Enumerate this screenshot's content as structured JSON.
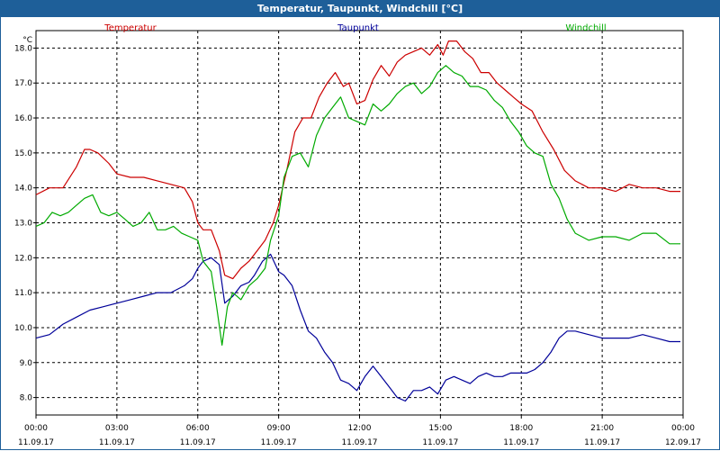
{
  "window": {
    "title": "Temperatur, Taupunkt, Windchill [°C]"
  },
  "chart_data": {
    "type": "line",
    "unit_label": "°C",
    "ylim": [
      7.5,
      18.5
    ],
    "yticks": [
      "8.0",
      "9.0",
      "10.0",
      "11.0",
      "12.0",
      "13.0",
      "14.0",
      "15.0",
      "16.0",
      "17.0",
      "18.0"
    ],
    "xlim": [
      0,
      24
    ],
    "xticks": [
      {
        "time": "00:00",
        "date": "11.09.17"
      },
      {
        "time": "03:00",
        "date": "11.09.17"
      },
      {
        "time": "06:00",
        "date": "11.09.17"
      },
      {
        "time": "09:00",
        "date": "11.09.17"
      },
      {
        "time": "12:00",
        "date": "11.09.17"
      },
      {
        "time": "15:00",
        "date": "11.09.17"
      },
      {
        "time": "18:00",
        "date": "11.09.17"
      },
      {
        "time": "21:00",
        "date": "11.09.17"
      },
      {
        "time": "00:00",
        "date": "12.09.17"
      }
    ],
    "grid": true,
    "legend_position": "top",
    "series": [
      {
        "name": "Temperatur",
        "color": "#cc0000",
        "x": [
          0,
          0.5,
          1,
          1.5,
          1.8,
          2,
          2.3,
          2.7,
          3,
          3.5,
          4,
          4.5,
          5,
          5.5,
          5.8,
          6,
          6.2,
          6.5,
          6.8,
          7,
          7.3,
          7.6,
          7.9,
          8.2,
          8.5,
          8.8,
          9,
          9.3,
          9.6,
          9.9,
          10.2,
          10.5,
          10.8,
          11.1,
          11.4,
          11.6,
          11.9,
          12.2,
          12.5,
          12.8,
          13.1,
          13.4,
          13.7,
          14,
          14.3,
          14.6,
          14.9,
          15.1,
          15.3,
          15.6,
          15.9,
          16.2,
          16.5,
          16.8,
          17.1,
          17.4,
          17.7,
          18,
          18.4,
          18.8,
          19.2,
          19.6,
          20,
          20.5,
          21,
          21.5,
          22,
          22.5,
          23,
          23.5,
          23.9
        ],
        "y": [
          13.8,
          14.0,
          14.0,
          14.6,
          15.1,
          15.1,
          15.0,
          14.7,
          14.4,
          14.3,
          14.3,
          14.2,
          14.1,
          14.0,
          13.6,
          13.0,
          12.8,
          12.8,
          12.2,
          11.5,
          11.4,
          11.7,
          11.9,
          12.2,
          12.5,
          13.0,
          13.5,
          14.5,
          15.6,
          16.0,
          16.0,
          16.6,
          17.0,
          17.3,
          16.9,
          17.0,
          16.4,
          16.5,
          17.1,
          17.5,
          17.2,
          17.6,
          17.8,
          17.9,
          18.0,
          17.8,
          18.1,
          17.8,
          18.2,
          18.2,
          17.9,
          17.7,
          17.3,
          17.3,
          17.0,
          16.8,
          16.6,
          16.4,
          16.2,
          15.6,
          15.1,
          14.5,
          14.2,
          14.0,
          14.0,
          13.9,
          14.1,
          14.0,
          14.0,
          13.9,
          13.9
        ]
      },
      {
        "name": "Taupunkt",
        "color": "#000099",
        "x": [
          0,
          0.5,
          1,
          1.5,
          2,
          2.5,
          3,
          3.5,
          4,
          4.5,
          5,
          5.5,
          5.8,
          6,
          6.2,
          6.5,
          6.8,
          7,
          7.3,
          7.6,
          7.9,
          8.1,
          8.4,
          8.7,
          9,
          9.2,
          9.5,
          9.8,
          10.1,
          10.4,
          10.7,
          11,
          11.3,
          11.6,
          11.9,
          12.2,
          12.5,
          12.8,
          13.1,
          13.4,
          13.7,
          14,
          14.3,
          14.6,
          14.9,
          15.2,
          15.5,
          15.8,
          16.1,
          16.4,
          16.7,
          17,
          17.3,
          17.6,
          17.9,
          18.2,
          18.5,
          18.8,
          19.1,
          19.4,
          19.7,
          20,
          20.5,
          21,
          21.5,
          22,
          22.5,
          23,
          23.5,
          23.9
        ],
        "y": [
          9.7,
          9.8,
          10.1,
          10.3,
          10.5,
          10.6,
          10.7,
          10.8,
          10.9,
          11.0,
          11.0,
          11.2,
          11.4,
          11.7,
          11.9,
          12.0,
          11.8,
          10.7,
          10.9,
          11.2,
          11.3,
          11.5,
          11.9,
          12.1,
          11.6,
          11.5,
          11.2,
          10.5,
          9.9,
          9.7,
          9.3,
          9.0,
          8.5,
          8.4,
          8.2,
          8.6,
          8.9,
          8.6,
          8.3,
          8.0,
          7.9,
          8.2,
          8.2,
          8.3,
          8.1,
          8.5,
          8.6,
          8.5,
          8.4,
          8.6,
          8.7,
          8.6,
          8.6,
          8.7,
          8.7,
          8.7,
          8.8,
          9.0,
          9.3,
          9.7,
          9.9,
          9.9,
          9.8,
          9.7,
          9.7,
          9.7,
          9.8,
          9.7,
          9.6,
          9.6
        ]
      },
      {
        "name": "Windchill",
        "color": "#00aa00",
        "x": [
          0,
          0.3,
          0.6,
          0.9,
          1.2,
          1.5,
          1.8,
          2.1,
          2.4,
          2.7,
          3,
          3.3,
          3.6,
          3.9,
          4.2,
          4.5,
          4.8,
          5.1,
          5.4,
          5.7,
          6,
          6.2,
          6.5,
          6.7,
          6.9,
          7.1,
          7.3,
          7.6,
          7.9,
          8.2,
          8.5,
          8.7,
          9,
          9.2,
          9.5,
          9.8,
          10.1,
          10.4,
          10.7,
          11,
          11.3,
          11.6,
          11.9,
          12.2,
          12.5,
          12.8,
          13.1,
          13.4,
          13.7,
          14,
          14.3,
          14.6,
          14.9,
          15.2,
          15.5,
          15.8,
          16.1,
          16.4,
          16.7,
          17,
          17.3,
          17.6,
          17.9,
          18.2,
          18.5,
          18.8,
          19.1,
          19.4,
          19.7,
          20,
          20.5,
          21,
          21.5,
          22,
          22.5,
          23,
          23.5,
          23.9
        ],
        "y": [
          12.9,
          13.0,
          13.3,
          13.2,
          13.3,
          13.5,
          13.7,
          13.8,
          13.3,
          13.2,
          13.3,
          13.1,
          12.9,
          13.0,
          13.3,
          12.8,
          12.8,
          12.9,
          12.7,
          12.6,
          12.5,
          11.9,
          11.6,
          10.6,
          9.5,
          10.6,
          11.0,
          10.8,
          11.2,
          11.4,
          11.7,
          12.5,
          13.2,
          14.3,
          14.9,
          15.0,
          14.6,
          15.5,
          16.0,
          16.3,
          16.6,
          16.0,
          15.9,
          15.8,
          16.4,
          16.2,
          16.4,
          16.7,
          16.9,
          17.0,
          16.7,
          16.9,
          17.3,
          17.5,
          17.3,
          17.2,
          16.9,
          16.9,
          16.8,
          16.5,
          16.3,
          15.9,
          15.6,
          15.2,
          15.0,
          14.9,
          14.1,
          13.7,
          13.1,
          12.7,
          12.5,
          12.6,
          12.6,
          12.5,
          12.7,
          12.7,
          12.4,
          12.4
        ]
      }
    ]
  }
}
